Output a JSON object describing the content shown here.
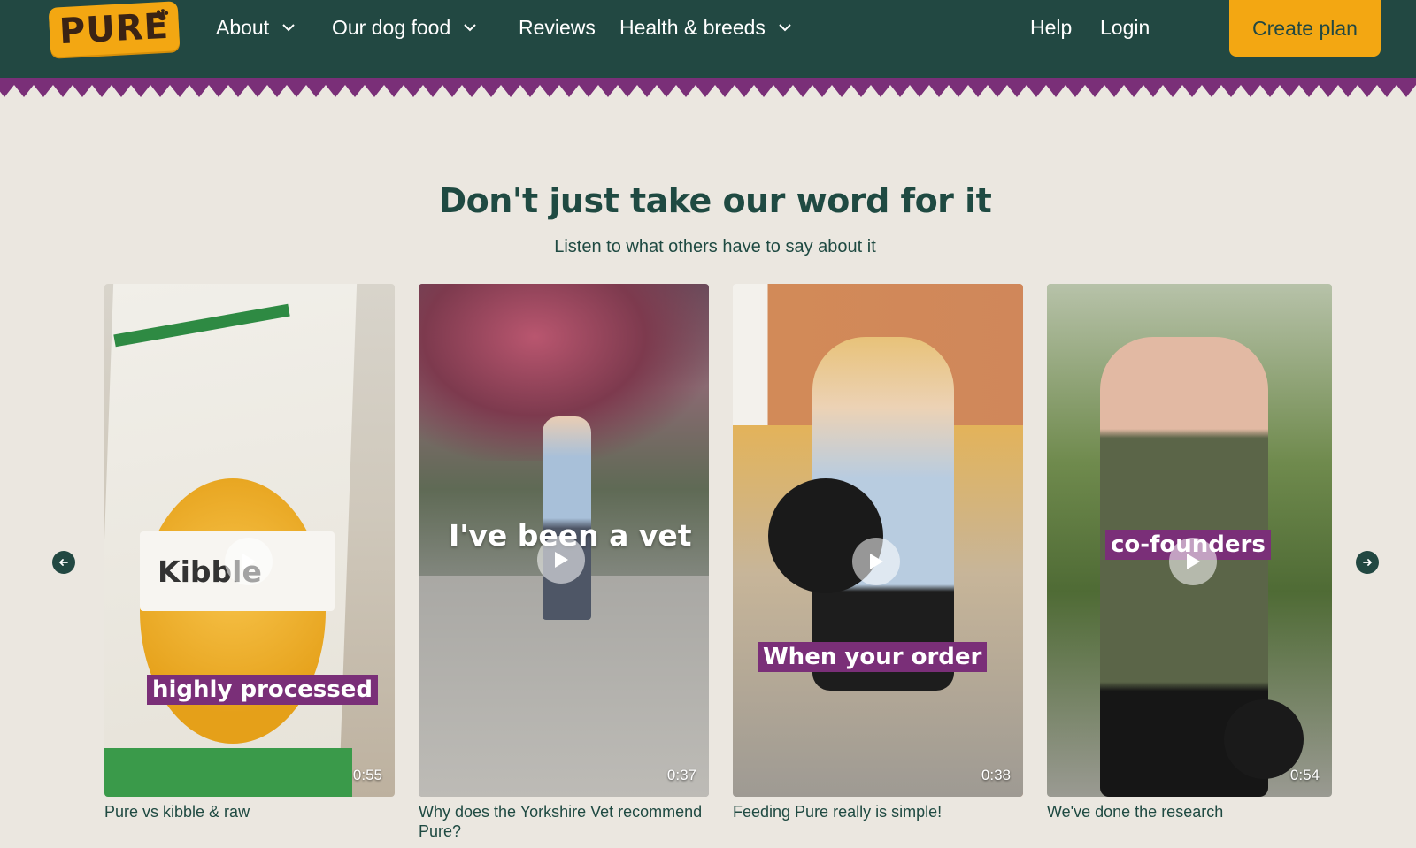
{
  "header": {
    "logo_text": "PURE",
    "nav": [
      {
        "label": "About"
      },
      {
        "label": "Our dog food"
      },
      {
        "label": "Reviews"
      },
      {
        "label": "Health & breeds"
      },
      {
        "label": "Help"
      },
      {
        "label": "Login"
      }
    ],
    "cta_label": "Create plan"
  },
  "section": {
    "title": "Don't just take our word for it",
    "subtitle": "Listen to what others have to say about it"
  },
  "videos": [
    {
      "caption": "Pure vs kibble & raw",
      "duration": "0:55",
      "overlay": "highly processed",
      "bag_text": "Kibble"
    },
    {
      "caption": "Why does the Yorkshire Vet recommend Pure?",
      "duration": "0:37",
      "overlay": "I've been a vet"
    },
    {
      "caption": "Feeding Pure really is simple!",
      "duration": "0:38",
      "overlay": "When your order"
    },
    {
      "caption": "We've done the research",
      "duration": "0:54",
      "overlay": "co-founders"
    }
  ],
  "colors": {
    "header_bg": "#224842",
    "accent": "#f3a712",
    "zigzag": "#7a2f78",
    "page_bg": "#ebe7e0"
  },
  "icons": [
    "chevron-down-icon",
    "arrow-left-icon",
    "arrow-right-icon",
    "play-icon",
    "paw-icon"
  ]
}
